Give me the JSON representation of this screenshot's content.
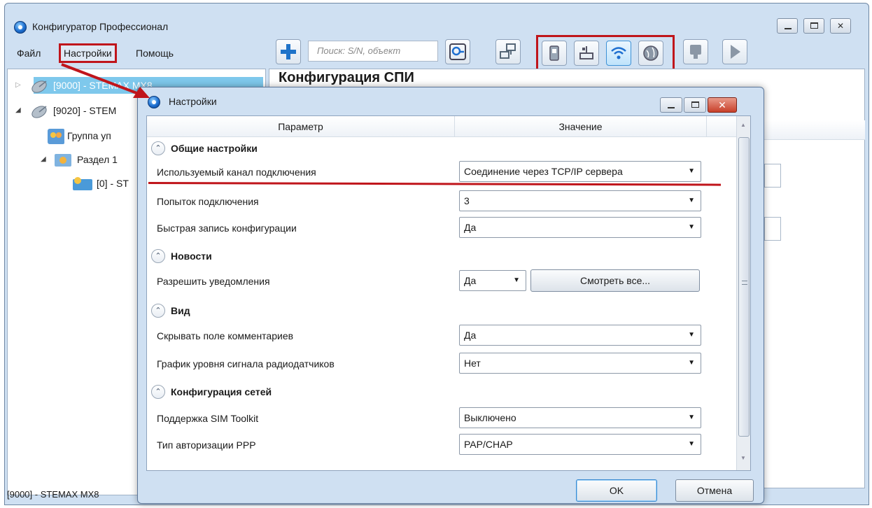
{
  "main": {
    "title": "Конфигуратор Профессионал",
    "menu": [
      "Файл",
      "Настройки",
      "Помощь"
    ],
    "search_placeholder": "Поиск: S/N, объект",
    "right_heading": "Конфигурация СПИ",
    "status": "[9000] - STEMAX MX8"
  },
  "tree": [
    {
      "label": "[9000] - STEMAX MX8",
      "icon": "satellite-icon"
    },
    {
      "label": "[9020] - STEM",
      "icon": "satellite-icon"
    },
    {
      "label": "Группа уп",
      "icon": "group-icon"
    },
    {
      "label": "Раздел 1",
      "icon": "section-icon"
    },
    {
      "label": "[0] - ST",
      "icon": "device-icon"
    }
  ],
  "dialog": {
    "title": "Настройки",
    "col_param": "Параметр",
    "col_value": "Значение",
    "sections": [
      {
        "title": "Общие настройки"
      },
      {
        "title": "Новости"
      },
      {
        "title": "Вид"
      },
      {
        "title": "Конфигурация сетей"
      }
    ],
    "params": [
      {
        "label": "Используемый канал подключения",
        "value": "Соединение через TCP/IP сервера"
      },
      {
        "label": "Попыток подключения",
        "value": "3"
      },
      {
        "label": "Быстрая запись конфигурации",
        "value": "Да"
      },
      {
        "label": "Разрешить уведомления",
        "value": "Да",
        "extra_button": "Смотреть все..."
      },
      {
        "label": "Скрывать поле комментариев",
        "value": "Да"
      },
      {
        "label": "График уровня сигнала радиодатчиков",
        "value": "Нет"
      },
      {
        "label": "Поддержка SIM Toolkit",
        "value": "Выключено"
      },
      {
        "label": "Тип авторизации PPP",
        "value": "PAP/CHAP"
      }
    ],
    "ok": "OK",
    "cancel": "Отмена"
  },
  "colors": {
    "annotation_red": "#c0151b",
    "tree_selected": "#7ec8ec"
  }
}
